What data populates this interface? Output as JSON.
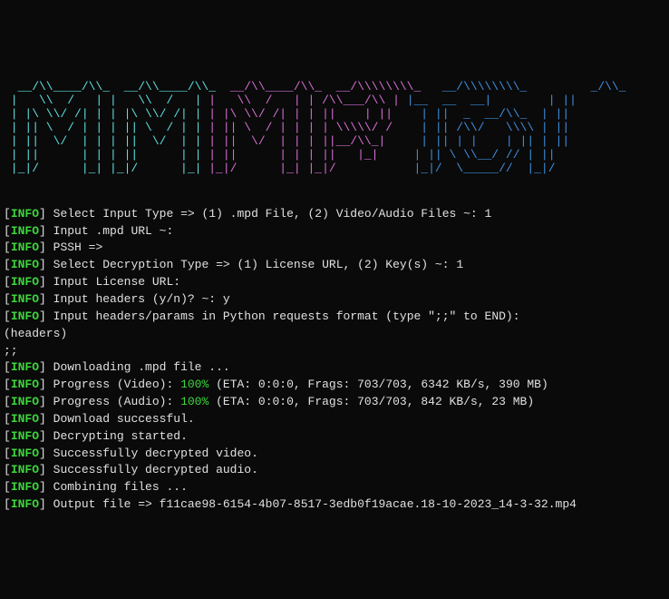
{
  "ascii": {
    "lines": [
      {
        "c1": "  __/\\\\____/\\\\_  __/\\\\____/\\\\_ ",
        "c2": " __/\\\\____/\\\\_  __/\\\\\\\\\\\\\\\\_  ",
        "c3": " __/\\\\\\\\\\\\\\\\_         _/\\\\_  "
      },
      {
        "c1": " |   \\\\  /   | |   \\\\  /   | ",
        "c2": "|   \\\\  /   | | /\\\\___/\\\\ | ",
        "c3": "|__  __  __|        | || "
      },
      {
        "c1": " | |\\ \\\\/ /| | | |\\ \\\\/ /| | ",
        "c2": "| |\\ \\\\/ /| | | ||    | || ",
        "c3": "   | ||  _  __/\\\\_  | || "
      },
      {
        "c1": " | || \\  / | | | || \\  / | | ",
        "c2": "| || \\  / | | | | \\\\\\\\\\/ / ",
        "c3": "   | || /\\\\/   \\\\\\\\ | || "
      },
      {
        "c1": " | ||  \\/  | | | ||  \\/  | | ",
        "c2": "| ||  \\/  | | | ||__/\\\\_|  ",
        "c3": "   | || | |    | || | || "
      },
      {
        "c1": " | ||      | | | ||      | | ",
        "c2": "| ||      | | | ||   |_|  ",
        "c3": "   | || \\ \\\\__/ // | || "
      },
      {
        "c1": " |_|/      |_| |_|/      |_| ",
        "c2": "|_|/      |_| |_|/        ",
        "c3": "   |_|/  \\_____//  |_|/ "
      }
    ]
  },
  "logs": [
    {
      "tag": "INFO",
      "text": " Select Input Type => (1) .mpd File, (2) Video/Audio Files ~: 1"
    },
    {
      "tag": "INFO",
      "text": " Input .mpd URL ~:"
    },
    {
      "tag": "INFO",
      "text": " PSSH =>"
    },
    {
      "tag": "INFO",
      "text": " Select Decryption Type => (1) License URL, (2) Key(s) ~: 1"
    },
    {
      "tag": "INFO",
      "text": " Input License URL:"
    },
    {
      "tag": "INFO",
      "text": " Input headers (y/n)? ~: y"
    },
    {
      "tag": "INFO",
      "text": " Input headers/params in Python requests format (type \";;\" to END):"
    }
  ],
  "plain": [
    "(headers)",
    ";;"
  ],
  "logs2": [
    {
      "tag": "INFO",
      "text": " Downloading .mpd file ..."
    },
    {
      "tag": "INFO",
      "pre": " Progress (Video): ",
      "pct": "100%",
      "post": " (ETA: 0:0:0, Frags: 703/703, 6342 KB/s, 390 MB)"
    },
    {
      "tag": "INFO",
      "pre": " Progress (Audio): ",
      "pct": "100%",
      "post": " (ETA: 0:0:0, Frags: 703/703, 842 KB/s, 23 MB)"
    },
    {
      "tag": "INFO",
      "text": " Download successful."
    },
    {
      "tag": "INFO",
      "text": " Decrypting started."
    },
    {
      "tag": "INFO",
      "text": " Successfully decrypted video."
    },
    {
      "tag": "INFO",
      "text": " Successfully decrypted audio."
    },
    {
      "tag": "INFO",
      "text": " Combining files ..."
    },
    {
      "tag": "INFO",
      "text": " Output file => f11cae98-6154-4b07-8517-3edb0f19acae.18-10-2023_14-3-32.mp4"
    }
  ]
}
